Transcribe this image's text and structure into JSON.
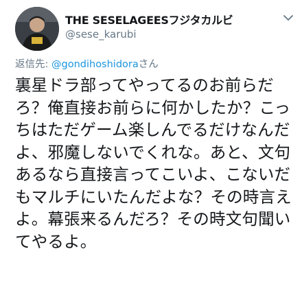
{
  "tweet": {
    "display_name": "THE SESELAGEESフジタカルビ",
    "handle": "@sese_karubi",
    "reply_prefix": "返信先: ",
    "reply_mention": "@gondihoshidora",
    "reply_suffix": "さん",
    "text": "裏星ドラ部ってやってるのお前らだろ？俺直接お前らに何かしたか？こっちはただゲーム楽しんでるだけなんだよ、邪魔しないでくれな。あと、文句あるなら直接言ってこいよ、こないだもマルチにいたんだよな？その時言えよ。幕張来るんだろ？その時文句聞いてやるよ。"
  },
  "icons": {
    "avatar": "profile-photo",
    "menu": "chevron-down-icon"
  },
  "colors": {
    "text": "#14171a",
    "secondary": "#657786",
    "link": "#1b95e0"
  }
}
